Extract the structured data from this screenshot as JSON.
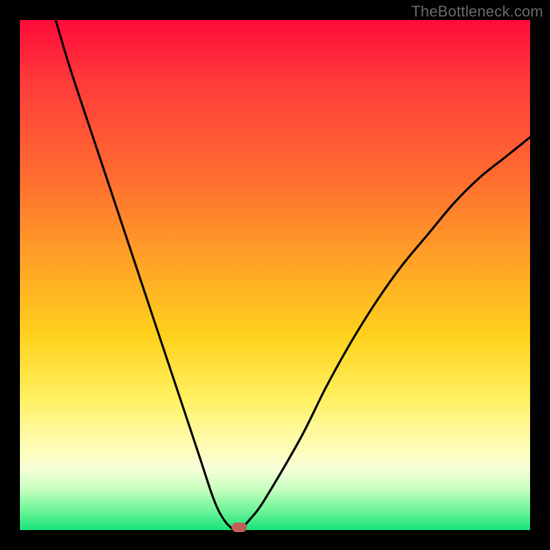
{
  "watermark": "TheBottleneck.com",
  "colors": {
    "frame": "#000000",
    "watermark_text": "#6b6b6b",
    "curve_stroke": "#000000",
    "marker_fill": "#c06058",
    "gradient_stops": [
      "#ff0a3a",
      "#ff3a3a",
      "#ff6a30",
      "#ffa526",
      "#ffd21c",
      "#fff060",
      "#fffcb0",
      "#f6ffd8",
      "#c8ffc0",
      "#70f59a",
      "#18e47a"
    ]
  },
  "chart_data": {
    "type": "line",
    "title": "",
    "xlabel": "",
    "ylabel": "",
    "xlim": [
      0,
      100
    ],
    "ylim": [
      0,
      100
    ],
    "series": [
      {
        "name": "bottleneck-curve",
        "x": [
          7,
          10,
          15,
          20,
          25,
          30,
          35,
          38,
          40,
          42,
          43,
          45,
          48,
          55,
          60,
          65,
          70,
          75,
          80,
          85,
          90,
          95,
          100
        ],
        "values": [
          100,
          90,
          75,
          60,
          45,
          30,
          15,
          6,
          2,
          0,
          0,
          2,
          6,
          18,
          28,
          37,
          45,
          52,
          58,
          64,
          69,
          73,
          77
        ]
      }
    ],
    "marker": {
      "x": 43,
      "y": 0.5,
      "label": "optimal-point"
    }
  }
}
